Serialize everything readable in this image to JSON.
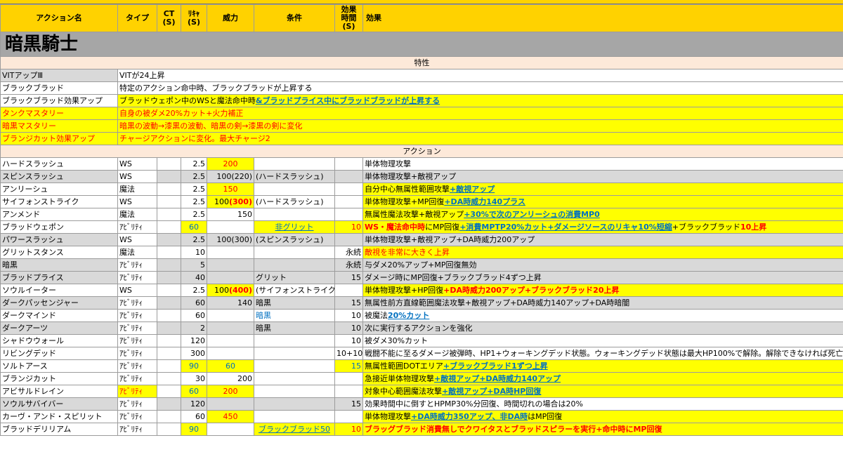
{
  "header": {
    "name": "アクション名",
    "type": "タイプ",
    "ct": "CT (S)",
    "recast": "ﾘｷｬ (S)",
    "power": "威力",
    "condition": "条件",
    "duration": "効果 時間 (S)",
    "effect": "効果"
  },
  "job_title": "暗黒騎士",
  "section_traits": "特性",
  "section_actions": "アクション",
  "traits": [
    {
      "name": "VITアップⅢ",
      "effect": "VITが24上昇"
    },
    {
      "name": "ブラックブラッド",
      "effect": "特定のアクション命中時、ブラックブラッドが上昇する"
    },
    {
      "name": "ブラックブラッド効果アップ",
      "effect_a": "ブラッドウェポン中のWSと魔法命中時",
      "effect_b": "&ブラッドプライス中にブラッドブラッドが上昇する"
    },
    {
      "name": "タンクマスタリー",
      "effect": "自身の被ダメ20%カット+火力補正"
    },
    {
      "name": "暗黒マスタリー",
      "effect": "暗黒の波動→漆黒の波動、暗黒の剣→漆黒の剣に変化"
    },
    {
      "name": "ブランジカット効果アップ",
      "effect": "チャージアクションに変化。最大チャージ2"
    }
  ],
  "actions": [
    {
      "name": "ハードスラッシュ",
      "type": "WS",
      "ct": "",
      "recast": "2.5",
      "power": "200",
      "cond": "",
      "dur": "",
      "effect": "単体物理攻撃"
    },
    {
      "name": "スピンスラッシュ",
      "type": "WS",
      "ct": "",
      "recast": "2.5",
      "power": "100(220)",
      "cond": "(ハードスラッシュ)",
      "dur": "",
      "effect": "単体物理攻撃+敵視アップ"
    },
    {
      "name": "アンリーシュ",
      "type": "魔法",
      "ct": "",
      "recast": "2.5",
      "power": "150",
      "cond": "",
      "dur": "",
      "effect_a": "自分中心無属性範囲攻撃",
      "effect_b": "+敵視アップ"
    },
    {
      "name": "サイフォンストライク",
      "type": "WS",
      "ct": "",
      "recast": "2.5",
      "power_a": "100",
      "power_b": "(300)",
      "cond": "(ハードスラッシュ)",
      "dur": "",
      "effect_a": "単体物理攻撃+MP回復",
      "effect_b": "+DA時威力140プラス"
    },
    {
      "name": "アンメンド",
      "type": "魔法",
      "ct": "",
      "recast": "2.5",
      "power": "150",
      "cond": "",
      "dur": "",
      "effect_a": "無属性魔法攻撃+敵視アップ",
      "effect_b": "+30%で次のアンリーシュの消費MP0"
    },
    {
      "name": "ブラッドウェポン",
      "type": "ｱﾋﾞﾘﾃｨ",
      "ct": "",
      "recast": "60",
      "power": "",
      "cond": "非グリット",
      "dur": "10",
      "effect_a": "WS・魔法命中時",
      "effect_b": "にMP回復",
      "effect_c": "+消費MPTP20%カット+ダメージソースのリキャ10%短縮",
      "effect_d": "+ブラックブラッド",
      "effect_e": "10上昇"
    },
    {
      "name": "パワースラッシュ",
      "type": "WS",
      "ct": "",
      "recast": "2.5",
      "power": "100(300)",
      "cond": "(スピンスラッシュ)",
      "dur": "",
      "effect": "単体物理攻撃+敵視アップ+DA時威力200アップ"
    },
    {
      "name": "グリットスタンス",
      "type": "魔法",
      "ct": "",
      "recast": "10",
      "power": "",
      "cond": "",
      "dur": "永続",
      "effect": "敵視を非常に大きく上昇"
    },
    {
      "name": "暗黒",
      "type": "ｱﾋﾞﾘﾃｨ",
      "ct": "",
      "recast": "5",
      "power": "",
      "cond": "",
      "dur": "永続",
      "effect": "与ダメ20%アップ+MP回復無効"
    },
    {
      "name": "ブラッドプライス",
      "type": "ｱﾋﾞﾘﾃｨ",
      "ct": "",
      "recast": "40",
      "power": "",
      "cond": "グリット",
      "dur": "15",
      "effect": "ダメージ時にMP回復+ブラックブラッド4ずつ上昇"
    },
    {
      "name": "ソウルイーター",
      "type": "WS",
      "ct": "",
      "recast": "2.5",
      "power_a": "100",
      "power_b": "(400)",
      "cond": "(サイフォンストライク)",
      "dur": "",
      "effect_a": "単体物理攻撃+HP回復",
      "effect_b": "+DA時威力200アップ+ブラックブラッド20上昇"
    },
    {
      "name": "ダークパッセンジャー",
      "type": "ｱﾋﾞﾘﾃｨ",
      "ct": "",
      "recast": "60",
      "power": "140",
      "cond": "暗黒",
      "dur": "15",
      "effect": "無属性前方直線範囲魔法攻撃+敵視アップ+DA時威力140アップ+DA時暗闇"
    },
    {
      "name": "ダークマインド",
      "type": "ｱﾋﾞﾘﾃｨ",
      "ct": "",
      "recast": "60",
      "power": "",
      "cond": "暗黒",
      "dur": "10",
      "effect_a": "被魔法",
      "effect_b": "20%カット"
    },
    {
      "name": "ダークアーツ",
      "type": "ｱﾋﾞﾘﾃｨ",
      "ct": "",
      "recast": "2",
      "power": "",
      "cond": "暗黒",
      "dur": "10",
      "effect": "次に実行するアクションを強化"
    },
    {
      "name": "シャドウウォール",
      "type": "ｱﾋﾞﾘﾃｨ",
      "ct": "",
      "recast": "120",
      "power": "",
      "cond": "",
      "dur": "10",
      "effect": "被ダメ30%カット"
    },
    {
      "name": "リビングデッド",
      "type": "ｱﾋﾞﾘﾃｨ",
      "ct": "",
      "recast": "300",
      "power": "",
      "cond": "",
      "dur": "10+10",
      "effect": "戦闘不能に至るダメージ被弾時、HP1+ウォーキングデッド状態。ウォーキングデッド状態は最大HP100%で解除。解除できなければ死亡"
    },
    {
      "name": "ソルトアース",
      "type": "ｱﾋﾞﾘﾃｨ",
      "ct": "",
      "recast": "90",
      "power": "60",
      "cond": "",
      "dur": "15",
      "effect_a": "無属性範囲DOTエリア",
      "effect_b": "+ブラックブラッド1ずつ上昇"
    },
    {
      "name": "ブランジカット",
      "type": "ｱﾋﾞﾘﾃｨ",
      "ct": "",
      "recast": "30",
      "power": "200",
      "cond": "",
      "dur": "",
      "effect_a": "急接近単体物理攻撃",
      "effect_b": "+敵視アップ+DA時威力140アップ"
    },
    {
      "name": "アビサルドレイン",
      "type": "ｱﾋﾞﾘﾃｨ",
      "ct": "",
      "recast": "60",
      "power": "200",
      "cond": "",
      "dur": "",
      "effect_a": "対象中心範囲魔法攻撃",
      "effect_b": "+敵視アップ+DA時HP回復"
    },
    {
      "name": "ソウルサバイバー",
      "type": "ｱﾋﾞﾘﾃｨ",
      "ct": "",
      "recast": "120",
      "power": "",
      "cond": "",
      "dur": "15",
      "effect": "効果時間中に倒すとHPMP30%分回復、時間切れの場合は20%"
    },
    {
      "name": "カーヴ・アンド・スピリット",
      "type": "ｱﾋﾞﾘﾃｨ",
      "ct": "",
      "recast": "60",
      "power": "450",
      "cond": "",
      "dur": "",
      "effect_a": "単体物理攻撃",
      "effect_b": "+DA時威力350アップ、非DA時",
      "effect_c": "はMP回復"
    },
    {
      "name": "ブラッドデリリアム",
      "type": "ｱﾋﾞﾘﾃｨ",
      "ct": "",
      "recast": "90",
      "power": "",
      "cond": "ブラックブラッド50",
      "dur": "10",
      "effect_a": "ブラッグブラッド消費無しでクワイタスとブラッドスピラーを実行",
      "effect_b": "+命中時にMP回復"
    }
  ]
}
